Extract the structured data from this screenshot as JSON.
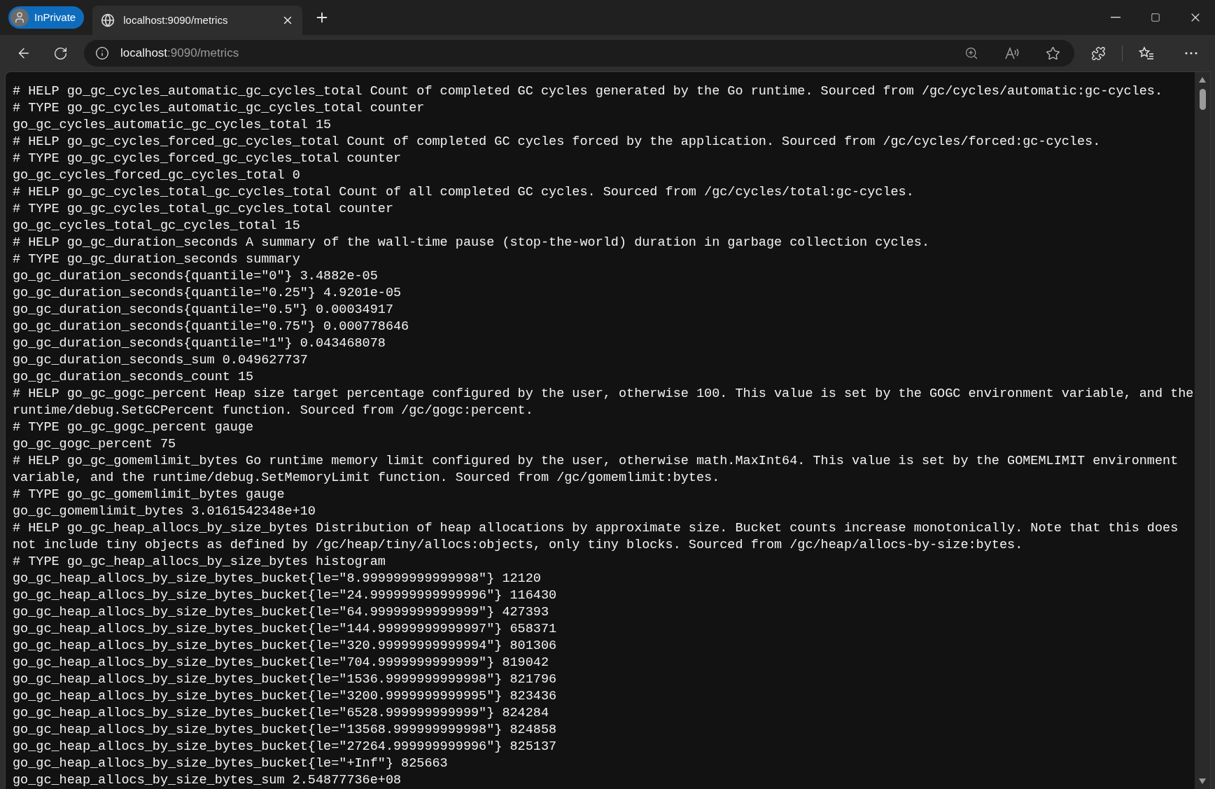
{
  "browser": {
    "profile_label": "InPrivate",
    "tab_title": "localhost:9090/metrics",
    "address": {
      "host": "localhost",
      "path": ":9090/metrics"
    }
  },
  "lines": [
    "# HELP go_gc_cycles_automatic_gc_cycles_total Count of completed GC cycles generated by the Go runtime. Sourced from /gc/cycles/automatic:gc-cycles.",
    "# TYPE go_gc_cycles_automatic_gc_cycles_total counter",
    "go_gc_cycles_automatic_gc_cycles_total 15",
    "# HELP go_gc_cycles_forced_gc_cycles_total Count of completed GC cycles forced by the application. Sourced from /gc/cycles/forced:gc-cycles.",
    "# TYPE go_gc_cycles_forced_gc_cycles_total counter",
    "go_gc_cycles_forced_gc_cycles_total 0",
    "# HELP go_gc_cycles_total_gc_cycles_total Count of all completed GC cycles. Sourced from /gc/cycles/total:gc-cycles.",
    "# TYPE go_gc_cycles_total_gc_cycles_total counter",
    "go_gc_cycles_total_gc_cycles_total 15",
    "# HELP go_gc_duration_seconds A summary of the wall-time pause (stop-the-world) duration in garbage collection cycles.",
    "# TYPE go_gc_duration_seconds summary",
    "go_gc_duration_seconds{quantile=\"0\"} 3.4882e-05",
    "go_gc_duration_seconds{quantile=\"0.25\"} 4.9201e-05",
    "go_gc_duration_seconds{quantile=\"0.5\"} 0.00034917",
    "go_gc_duration_seconds{quantile=\"0.75\"} 0.000778646",
    "go_gc_duration_seconds{quantile=\"1\"} 0.043468078",
    "go_gc_duration_seconds_sum 0.049627737",
    "go_gc_duration_seconds_count 15",
    "# HELP go_gc_gogc_percent Heap size target percentage configured by the user, otherwise 100. This value is set by the GOGC environment variable, and the runtime/debug.SetGCPercent function. Sourced from /gc/gogc:percent.",
    "# TYPE go_gc_gogc_percent gauge",
    "go_gc_gogc_percent 75",
    "# HELP go_gc_gomemlimit_bytes Go runtime memory limit configured by the user, otherwise math.MaxInt64. This value is set by the GOMEMLIMIT environment variable, and the runtime/debug.SetMemoryLimit function. Sourced from /gc/gomemlimit:bytes.",
    "# TYPE go_gc_gomemlimit_bytes gauge",
    "go_gc_gomemlimit_bytes 3.0161542348e+10",
    "# HELP go_gc_heap_allocs_by_size_bytes Distribution of heap allocations by approximate size. Bucket counts increase monotonically. Note that this does not include tiny objects as defined by /gc/heap/tiny/allocs:objects, only tiny blocks. Sourced from /gc/heap/allocs-by-size:bytes.",
    "# TYPE go_gc_heap_allocs_by_size_bytes histogram",
    "go_gc_heap_allocs_by_size_bytes_bucket{le=\"8.999999999999998\"} 12120",
    "go_gc_heap_allocs_by_size_bytes_bucket{le=\"24.999999999999996\"} 116430",
    "go_gc_heap_allocs_by_size_bytes_bucket{le=\"64.99999999999999\"} 427393",
    "go_gc_heap_allocs_by_size_bytes_bucket{le=\"144.99999999999997\"} 658371",
    "go_gc_heap_allocs_by_size_bytes_bucket{le=\"320.99999999999994\"} 801306",
    "go_gc_heap_allocs_by_size_bytes_bucket{le=\"704.9999999999999\"} 819042",
    "go_gc_heap_allocs_by_size_bytes_bucket{le=\"1536.9999999999998\"} 821796",
    "go_gc_heap_allocs_by_size_bytes_bucket{le=\"3200.9999999999995\"} 823436",
    "go_gc_heap_allocs_by_size_bytes_bucket{le=\"6528.999999999999\"} 824284",
    "go_gc_heap_allocs_by_size_bytes_bucket{le=\"13568.999999999998\"} 824858",
    "go_gc_heap_allocs_by_size_bytes_bucket{le=\"27264.999999999996\"} 825137",
    "go_gc_heap_allocs_by_size_bytes_bucket{le=\"+Inf\"} 825663",
    "go_gc_heap_allocs_by_size_bytes_sum 2.54877736e+08"
  ]
}
